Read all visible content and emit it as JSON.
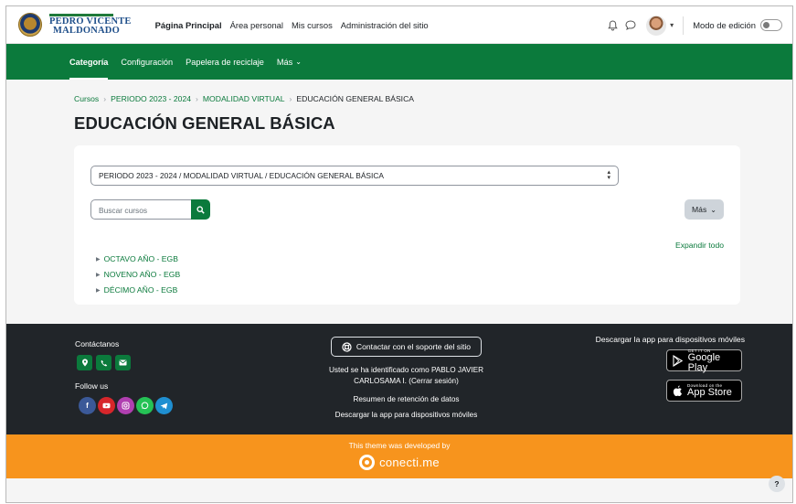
{
  "brand": {
    "line1": "PEDRO VICENTE",
    "line2": "MALDONADO"
  },
  "topnav": {
    "items": [
      "Página Principal",
      "Área personal",
      "Mis cursos",
      "Administración del sitio"
    ],
    "edit_mode_label": "Modo de edición",
    "edit_mode_on": false
  },
  "subnav": {
    "items": [
      "Categoría",
      "Configuración",
      "Papelera de reciclaje",
      "Más"
    ]
  },
  "breadcrumb": [
    "Cursos",
    "PERIODO 2023 - 2024",
    "MODALIDAD VIRTUAL",
    "EDUCACIÓN GENERAL BÁSICA"
  ],
  "page_title": "EDUCACIÓN GENERAL BÁSICA",
  "category_select": {
    "value": "PERIODO 2023 - 2024 / MODALIDAD VIRTUAL / EDUCACIÓN GENERAL BÁSICA"
  },
  "search": {
    "placeholder": "Buscar cursos"
  },
  "more_button": "Más",
  "expand_all": "Expandir todo",
  "categories": [
    "OCTAVO AÑO - EGB",
    "NOVENO AÑO - EGB",
    "DÉCIMO AÑO - EGB"
  ],
  "footer": {
    "contact_title": "Contáctanos",
    "follow_title": "Follow us",
    "support_button": "Contactar con el soporte del sitio",
    "logged_in_line1": "Usted se ha identificado como PABLO JAVIER",
    "logged_in_line2": "CARLOSAMA I. (Cerrar sesión)",
    "data_retention": "Resumen de retención de datos",
    "get_app": "Descargar la app para dispositivos móviles",
    "apps_title": "Descargar la app para dispositivos móviles",
    "google_play": {
      "small": "GET IT ON",
      "big": "Google Play"
    },
    "app_store": {
      "small": "Download on the",
      "big": "App Store"
    }
  },
  "developer_bar": {
    "text": "This theme was developed by",
    "brand": "conecti.me"
  },
  "help_button": "?",
  "colors": {
    "primary_green": "#0b7a3c",
    "footer_dark": "#212529",
    "orange": "#f7941d"
  }
}
